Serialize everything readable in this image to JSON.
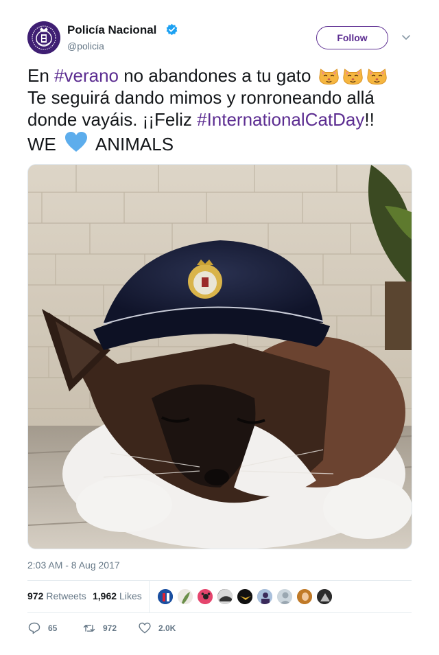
{
  "author": {
    "display_name": "Policía Nacional",
    "handle": "@policia",
    "avatar_icon": "police-badge-icon",
    "verified_icon": "verified-badge-icon",
    "avatar_color": "#3f1f73"
  },
  "follow_button": {
    "label": "Follow"
  },
  "caret_icon": "chevron-down-icon",
  "text": {
    "line1": {
      "t1": "En ",
      "tag1": "#verano",
      "t2": " no abandones a tu gato "
    },
    "line2": "Te seguirá dando mimos y ronroneando allá",
    "line3": {
      "t1": "donde vayáis. ¡¡Feliz ",
      "tag1": "#InternationalCatDay",
      "t2": "!!"
    },
    "line4": {
      "t1": "WE ",
      "t2": " ANIMALS"
    },
    "emoji_cat": "cat-face-emoji",
    "emoji_heart": "blue-heart-emoji"
  },
  "media": {
    "description_icon": "cat-in-police-cap-photo"
  },
  "timestamp": "2:03 AM - 8 Aug 2017",
  "stats": {
    "retweets_count": "972",
    "retweets_label": "Retweets",
    "likes_count": "1,962",
    "likes_label": "Likes",
    "liker_avatar_count": 9
  },
  "actions": {
    "reply_count": "65",
    "retweet_count": "972",
    "like_count": "2.0K"
  },
  "colors": {
    "accent": "#5c2d91",
    "muted": "#657786",
    "text": "#14171a",
    "verified": "#1da1f2"
  }
}
